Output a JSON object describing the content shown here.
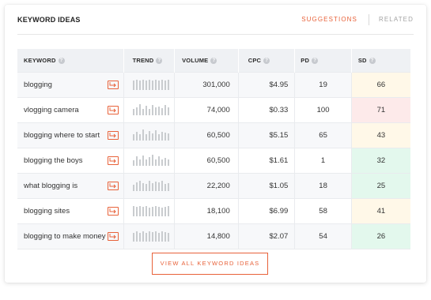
{
  "header": {
    "title": "KEYWORD IDEAS"
  },
  "tabs": [
    {
      "label": "SUGGESTIONS",
      "active": true
    },
    {
      "label": "RELATED",
      "active": false
    }
  ],
  "table": {
    "columns": [
      "KEYWORD",
      "TREND",
      "VOLUME",
      "CPC",
      "PD",
      "SD"
    ],
    "rows": [
      {
        "keyword": "blogging",
        "volume": "301,000",
        "cpc": "$4.95",
        "pd": "19",
        "sd": "66",
        "sd_color": "#fff8e8"
      },
      {
        "keyword": "vlogging camera",
        "volume": "74,000",
        "cpc": "$0.33",
        "pd": "100",
        "sd": "71",
        "sd_color": "#fdeaea"
      },
      {
        "keyword": "blogging where to start",
        "volume": "60,500",
        "cpc": "$5.15",
        "pd": "65",
        "sd": "43",
        "sd_color": "#fff8e8"
      },
      {
        "keyword": "blogging the boys",
        "volume": "60,500",
        "cpc": "$1.61",
        "pd": "1",
        "sd": "32",
        "sd_color": "#e3f8ed"
      },
      {
        "keyword": "what blogging is",
        "volume": "22,200",
        "cpc": "$1.05",
        "pd": "18",
        "sd": "25",
        "sd_color": "#e3f8ed"
      },
      {
        "keyword": "blogging sites",
        "volume": "18,100",
        "cpc": "$6.99",
        "pd": "58",
        "sd": "41",
        "sd_color": "#fff8e8"
      },
      {
        "keyword": "blogging to make money",
        "volume": "14,800",
        "cpc": "$2.07",
        "pd": "54",
        "sd": "26",
        "sd_color": "#e3f8ed"
      }
    ]
  },
  "trends": [
    [
      0.85,
      0.9,
      0.85,
      0.9,
      0.85,
      0.9,
      0.85,
      0.9,
      0.85,
      0.9,
      0.85,
      0.9
    ],
    [
      0.55,
      0.7,
      1.0,
      0.6,
      0.85,
      0.55,
      0.9,
      0.7,
      0.75,
      0.65,
      0.95,
      0.7
    ],
    [
      0.6,
      0.75,
      0.55,
      1.0,
      0.6,
      0.85,
      0.65,
      0.9,
      0.6,
      0.8,
      0.7,
      0.65
    ],
    [
      0.5,
      0.85,
      0.55,
      0.95,
      0.6,
      0.75,
      1.0,
      0.55,
      0.85,
      0.6,
      0.7,
      0.55
    ],
    [
      0.6,
      0.8,
      0.95,
      0.7,
      0.65,
      0.9,
      0.7,
      0.85,
      0.75,
      0.9,
      0.65,
      0.7
    ],
    [
      0.95,
      0.85,
      0.9,
      0.85,
      0.9,
      0.8,
      0.85,
      0.9,
      0.85,
      0.8,
      0.85,
      0.9
    ],
    [
      0.75,
      0.9,
      0.8,
      0.95,
      0.8,
      0.9,
      0.85,
      0.95,
      0.8,
      0.9,
      0.85,
      0.8
    ]
  ],
  "footer": {
    "view_all_label": "VIEW ALL KEYWORD IDEAS"
  },
  "colors": {
    "accent": "#e8623a",
    "header_bg": "#eff1f4"
  },
  "icons": {
    "help": "help-circle-icon",
    "go": "external-link-arrow-icon"
  }
}
